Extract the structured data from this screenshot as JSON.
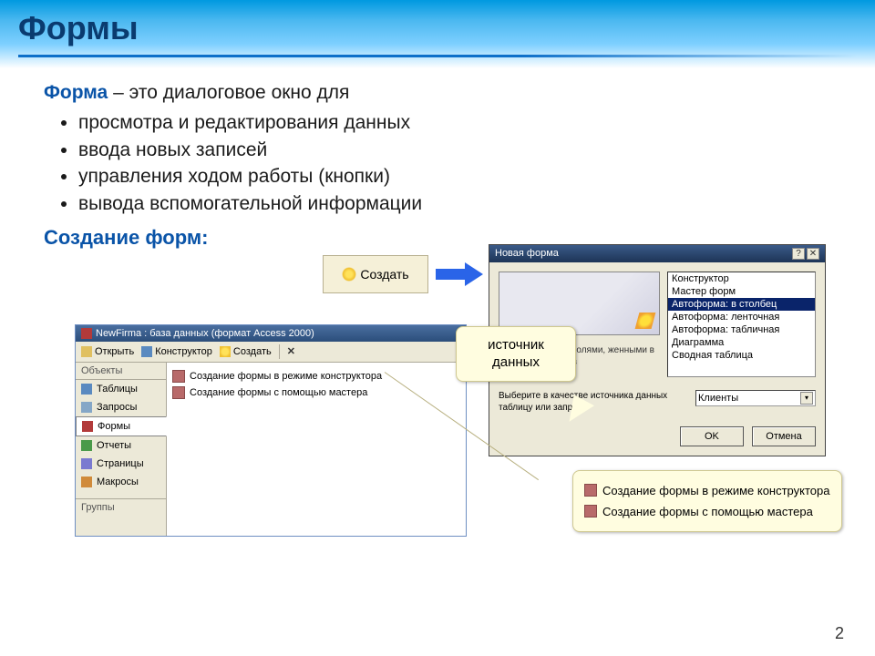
{
  "slide": {
    "title": "Формы",
    "term": "Форма",
    "definition_tail": " – это диалоговое окно для",
    "bullets": [
      "просмотра и редактирования данных",
      "ввода новых записей",
      "управления ходом работы (кнопки)",
      "вывода вспомогательной информации"
    ],
    "subtitle": "Создание форм:",
    "page_number": "2"
  },
  "create_button": {
    "label": "Создать"
  },
  "db_window": {
    "title": "NewFirma : база данных (формат Access 2000)",
    "toolbar": {
      "open": "Открыть",
      "designer": "Конструктор",
      "create": "Создать"
    },
    "sidebar_header": "Объекты",
    "sidebar": {
      "tables": "Таблицы",
      "queries": "Запросы",
      "forms": "Формы",
      "reports": "Отчеты",
      "pages": "Страницы",
      "macros": "Макросы"
    },
    "groups_header": "Группы",
    "main_items": [
      "Создание формы в режиме конструктора",
      "Создание формы с помощью мастера"
    ]
  },
  "newform_dialog": {
    "title": "Новая форма",
    "close_help": "?",
    "close_x": "✕",
    "list": [
      "Конструктор",
      "Мастер форм",
      "Автоформа: в столбец",
      "Автоформа: ленточная",
      "Автоформа: табличная",
      "Диаграмма",
      "Сводная таблица"
    ],
    "selected_index": 2,
    "description": "ческое создание\nполями,\nженными в один\nько столбцов",
    "prompt": "Выберите в качестве источника данных таблицу или запрос:",
    "source_value": "Клиенты",
    "ok": "OK",
    "cancel": "Отмена"
  },
  "callouts": {
    "data_source": "источник данных",
    "create_items": [
      "Создание формы в режиме конструктора",
      "Создание формы с помощью мастера"
    ]
  }
}
